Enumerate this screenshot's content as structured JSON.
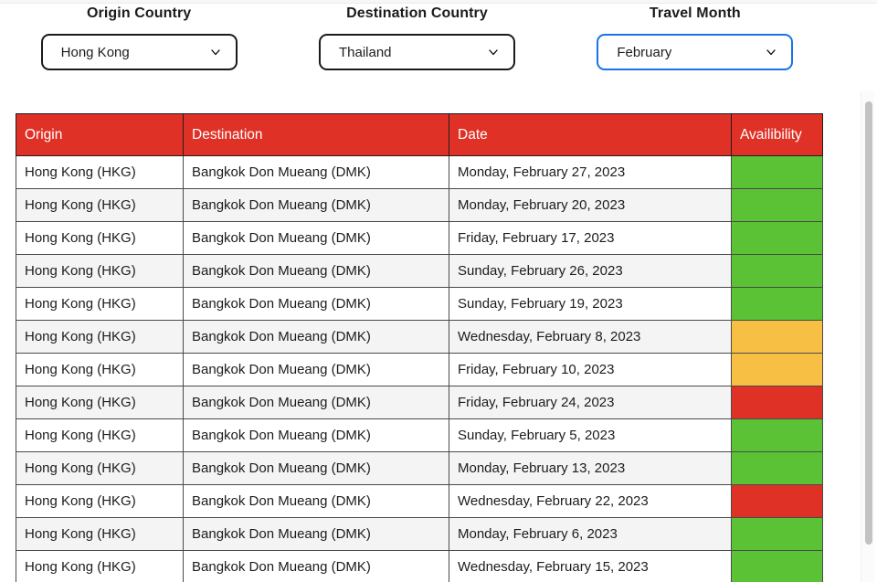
{
  "filters": [
    {
      "label": "Origin Country",
      "value": "Hong Kong",
      "name": "origin-country-select",
      "focused": false
    },
    {
      "label": "Destination Country",
      "value": "Thailand",
      "name": "destination-country-select",
      "focused": false
    },
    {
      "label": "Travel Month",
      "value": "February",
      "name": "travel-month-select",
      "focused": true
    }
  ],
  "table": {
    "columns": [
      "Origin",
      "Destination",
      "Date",
      "Availibility"
    ],
    "colors": {
      "header_red": "#e03127",
      "available_green": "#5bc236",
      "limited_orange": "#f7bf43",
      "full_red": "#e03127",
      "row_stripe": "#f4f4f4"
    },
    "rows": [
      {
        "origin": "Hong Kong (HKG)",
        "destination": "Bangkok Don Mueang (DMK)",
        "date": "Monday, February 27, 2023",
        "availability": "available"
      },
      {
        "origin": "Hong Kong (HKG)",
        "destination": "Bangkok Don Mueang (DMK)",
        "date": "Monday, February 20, 2023",
        "availability": "available"
      },
      {
        "origin": "Hong Kong (HKG)",
        "destination": "Bangkok Don Mueang (DMK)",
        "date": "Friday, February 17, 2023",
        "availability": "available"
      },
      {
        "origin": "Hong Kong (HKG)",
        "destination": "Bangkok Don Mueang (DMK)",
        "date": "Sunday, February 26, 2023",
        "availability": "available"
      },
      {
        "origin": "Hong Kong (HKG)",
        "destination": "Bangkok Don Mueang (DMK)",
        "date": "Sunday, February 19, 2023",
        "availability": "available"
      },
      {
        "origin": "Hong Kong (HKG)",
        "destination": "Bangkok Don Mueang (DMK)",
        "date": "Wednesday, February 8, 2023",
        "availability": "limited"
      },
      {
        "origin": "Hong Kong (HKG)",
        "destination": "Bangkok Don Mueang (DMK)",
        "date": "Friday, February 10, 2023",
        "availability": "limited"
      },
      {
        "origin": "Hong Kong (HKG)",
        "destination": "Bangkok Don Mueang (DMK)",
        "date": "Friday, February 24, 2023",
        "availability": "full"
      },
      {
        "origin": "Hong Kong (HKG)",
        "destination": "Bangkok Don Mueang (DMK)",
        "date": "Sunday, February 5, 2023",
        "availability": "available"
      },
      {
        "origin": "Hong Kong (HKG)",
        "destination": "Bangkok Don Mueang (DMK)",
        "date": "Monday, February 13, 2023",
        "availability": "available"
      },
      {
        "origin": "Hong Kong (HKG)",
        "destination": "Bangkok Don Mueang (DMK)",
        "date": "Wednesday, February 22, 2023",
        "availability": "full"
      },
      {
        "origin": "Hong Kong (HKG)",
        "destination": "Bangkok Don Mueang (DMK)",
        "date": "Monday, February 6, 2023",
        "availability": "available"
      },
      {
        "origin": "Hong Kong (HKG)",
        "destination": "Bangkok Don Mueang (DMK)",
        "date": "Wednesday, February 15, 2023",
        "availability": "available"
      }
    ]
  }
}
